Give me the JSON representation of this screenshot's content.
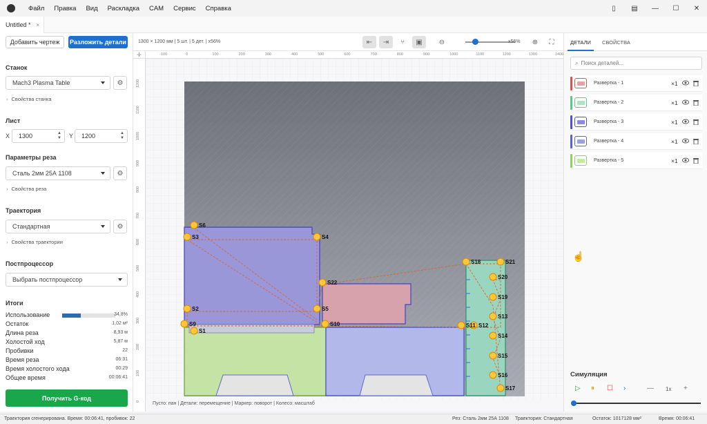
{
  "menu": [
    "Файл",
    "Правка",
    "Вид",
    "Раскладка",
    "CAM",
    "Сервис",
    "Справка"
  ],
  "window_controls": [
    "▯",
    "▤",
    "—",
    "☐",
    "✕"
  ],
  "tab": {
    "title": "Untitled *",
    "close": "×"
  },
  "left": {
    "add_drawing": "Добавить чертеж",
    "nest": "Разложить детали",
    "machine_title": "Станок",
    "machine_value": "Mach3 Plasma Table",
    "machine_props": "Свойства станка",
    "sheet_title": "Лист",
    "x_label": "X",
    "x_value": "1300",
    "y_label": "Y",
    "y_value": "1200",
    "cut_title": "Параметры реза",
    "cut_value": "Сталь 2мм 25А 1108",
    "cut_props": "Свойства реза",
    "traj_title": "Траектория",
    "traj_value": "Стандартная",
    "traj_props": "Свойства траектории",
    "post_title": "Постпроцессор",
    "post_value": "Выбрать постпроцессор",
    "totals_title": "Итоги",
    "stats": [
      {
        "label": "Использование",
        "value": "34,8%"
      },
      {
        "label": "Остаток",
        "value": "1,02 м²"
      },
      {
        "label": "Длина реза",
        "value": "8,93 м"
      },
      {
        "label": "Холостой ход",
        "value": "5,87 м"
      },
      {
        "label": "Пробивки",
        "value": "22"
      },
      {
        "label": "Время реза",
        "value": "06:31"
      },
      {
        "label": "Время холостого хода",
        "value": "00:29"
      },
      {
        "label": "Общее время",
        "value": "00:06:41"
      }
    ],
    "usage_fraction": 0.348,
    "gcode_button": "Получить G-код"
  },
  "toolbar": {
    "info": "1300 × 1200 мм  |  5 шт.  |  5 дет.  |  x56%",
    "zoom_label": "x56%",
    "zoom_fraction": 0.2
  },
  "ruler": {
    "x_ticks": [
      "-100",
      "0",
      "100",
      "200",
      "300",
      "400",
      "500",
      "600",
      "700",
      "800",
      "900",
      "1000",
      "1100",
      "1200",
      "1300",
      "1400"
    ],
    "y_ticks": [
      "1200",
      "1100",
      "1000",
      "900",
      "800",
      "700",
      "600",
      "500",
      "400",
      "300",
      "200",
      "100",
      "0"
    ]
  },
  "canvas_hint": "Пусто: пан | Детали: перемещение | Маркер: поворот | Колесо: масштаб",
  "pierce_labels": [
    "S1",
    "S2",
    "S3",
    "S4",
    "S5",
    "S6",
    "S9",
    "S10",
    "S11",
    "S12",
    "S13",
    "S14",
    "S15",
    "S16",
    "S17",
    "S18",
    "S19",
    "S20",
    "S21",
    "S22"
  ],
  "right": {
    "tab_parts": "ДЕТАЛИ",
    "tab_props": "СВОЙСТВА",
    "search_placeholder": "Поиск деталей...",
    "parts": [
      {
        "name": "Развертка - 1",
        "qty": "×1",
        "color": "#d9534f",
        "fill": "#e8a0a8"
      },
      {
        "name": "Развертка - 2",
        "qty": "×1",
        "color": "#5cc98a",
        "fill": "#a8e6c4"
      },
      {
        "name": "Развертка - 3",
        "qty": "×1",
        "color": "#5552c9",
        "fill": "#8c89de"
      },
      {
        "name": "Развертка - 4",
        "qty": "×1",
        "color": "#5a63c8",
        "fill": "#9aa0e0"
      },
      {
        "name": "Развертка - 5",
        "qty": "×1",
        "color": "#8fd35a",
        "fill": "#c4eaa0"
      }
    ],
    "sim_title": "Симуляция",
    "sim_speed": "1x",
    "sim_progress": 0.0
  },
  "status": {
    "left": "Траектория сгенерирована. Время: 00:06:41, пробивок: 22",
    "cut": "Рез: Сталь 2мм 25А 1108",
    "traj": "Траектория: Стандартная",
    "remain": "Остаток: 1017128 мм²",
    "time": "Время: 00:06:41"
  }
}
